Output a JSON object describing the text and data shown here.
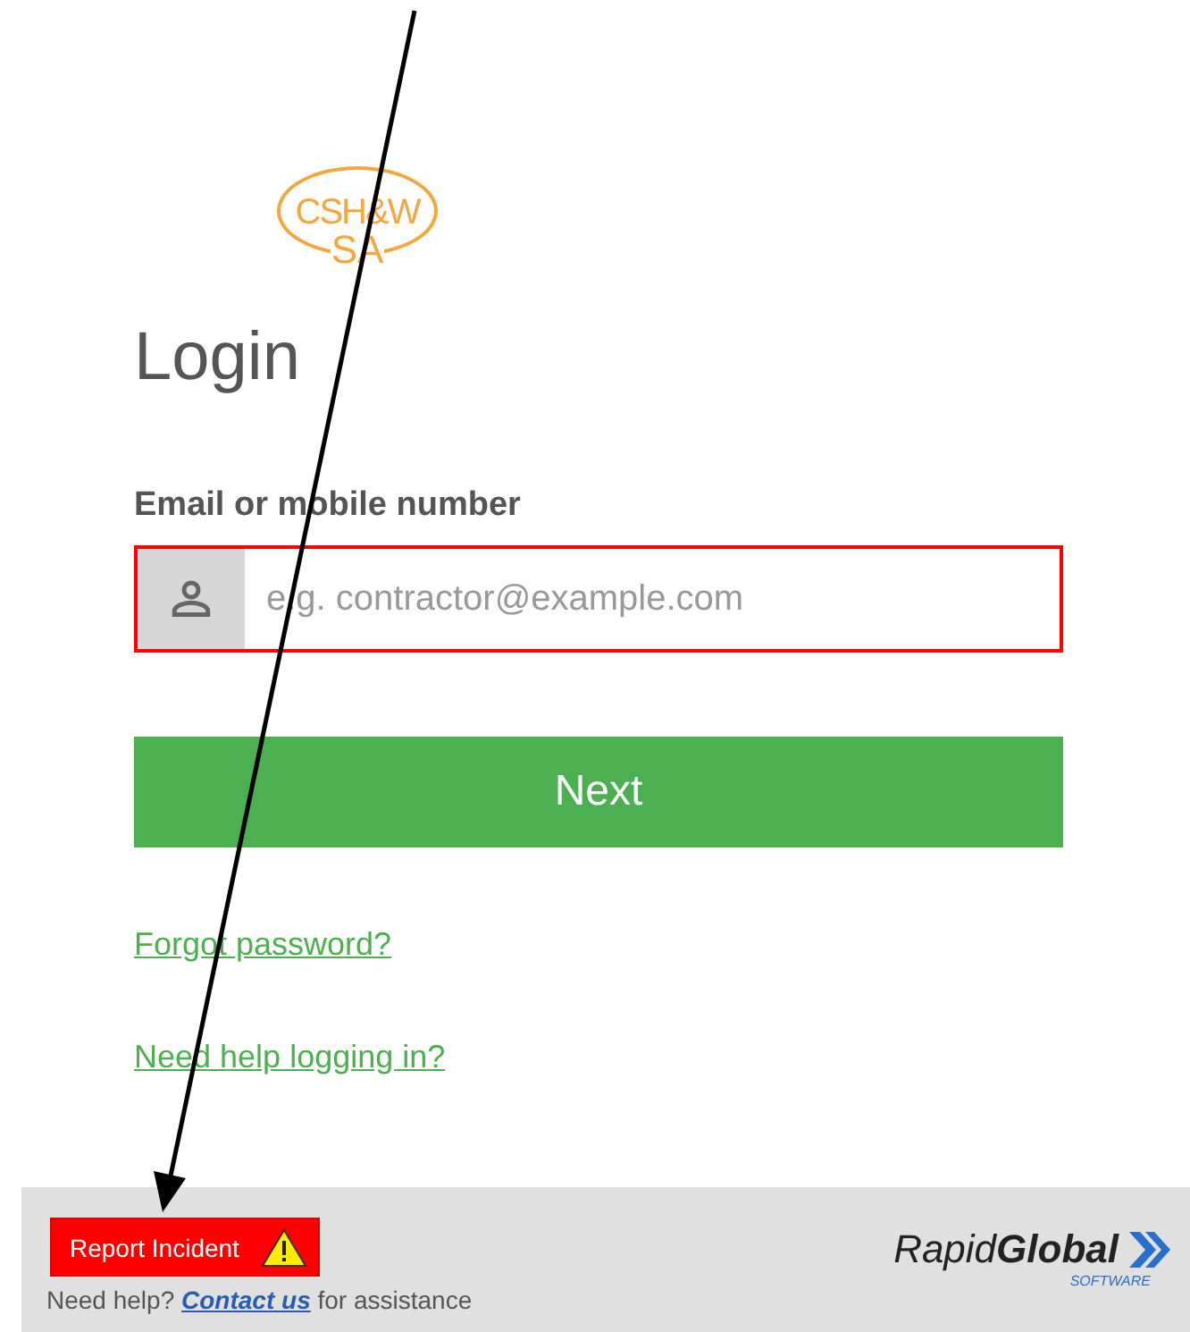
{
  "logo": {
    "line_1": "CSH&W",
    "line_2": "SA"
  },
  "title": "Login",
  "email_field": {
    "label": "Email or mobile number",
    "placeholder": "e.g. contractor@example.com",
    "invalid": true
  },
  "next_button": "Next",
  "links": [
    "Forgot password?",
    "Need help logging in?"
  ],
  "footer": {
    "report_button": "Report Incident",
    "help_prefix": "Need help?",
    "help_link": "Contact us",
    "help_suffix": "for assistance",
    "brand": {
      "part_1": "Rapid",
      "part_2": "Global",
      "tagline": "SOFTWARE"
    }
  },
  "annotation_arrow": true
}
